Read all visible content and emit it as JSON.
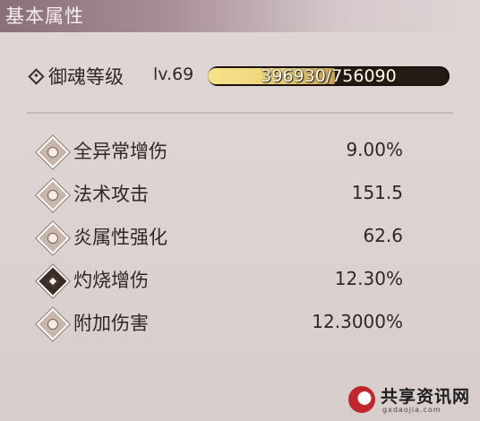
{
  "panel": {
    "title": "基本属性"
  },
  "level": {
    "label": "御魂等级",
    "value": "lv.69",
    "xp_text": "396930/756090",
    "xp_current": 396930,
    "xp_max": 756090
  },
  "stats": [
    {
      "name": "全异常增伤",
      "value": "9.00%",
      "icon": "mask-face-icon"
    },
    {
      "name": "法术攻击",
      "value": "151.5",
      "icon": "spell-flame-icon"
    },
    {
      "name": "炎属性强化",
      "value": "62.6",
      "icon": "fire-swirl-icon"
    },
    {
      "name": "灼烧增伤",
      "value": "12.30%",
      "icon": "burn-diamond-icon"
    },
    {
      "name": "附加伤害",
      "value": "12.3000%",
      "icon": "extra-damage-icon"
    }
  ],
  "watermark": {
    "text": "共享资讯网",
    "url": "gxdaojia.com"
  },
  "colors": {
    "xp_fill": "#f6e38a",
    "text": "#2f2727",
    "title_bar": "#8a6f78"
  }
}
